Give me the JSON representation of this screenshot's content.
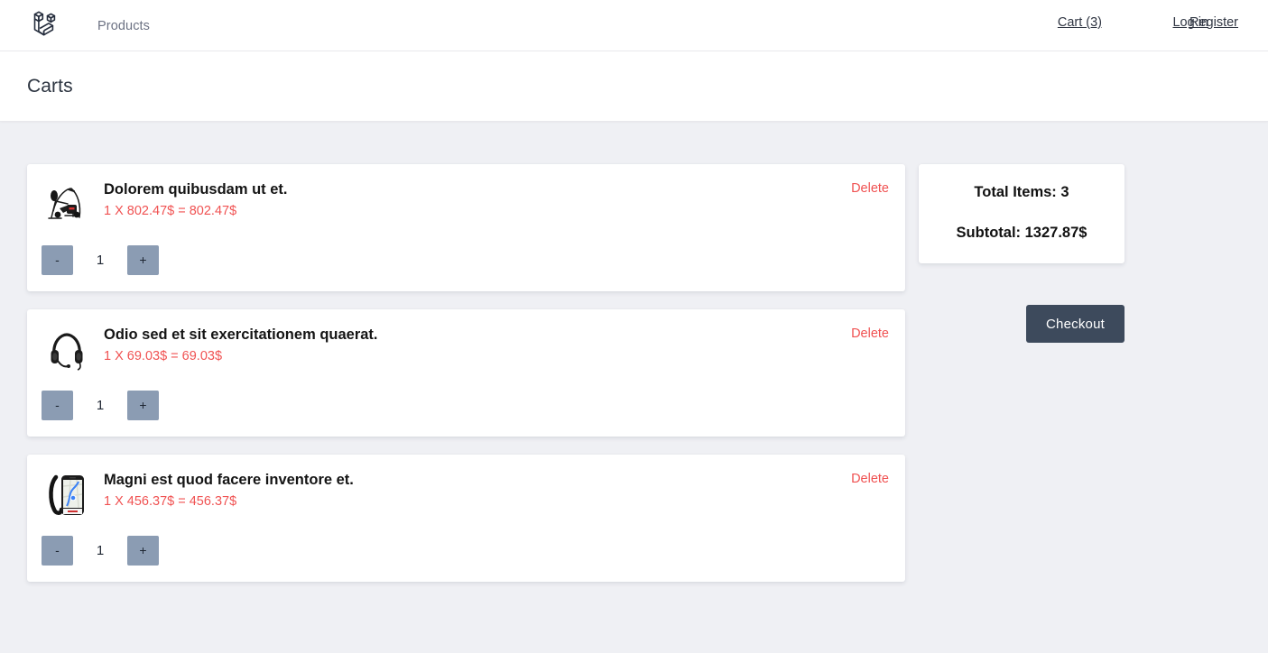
{
  "navbar": {
    "logo_name": "laravel-logo",
    "products_label": "Products",
    "cart_label": "Cart (3)",
    "login_label": "Log in",
    "register_label": "Register"
  },
  "page": {
    "title": "Carts"
  },
  "cart": {
    "items": [
      {
        "image": "elliptical-trainer-photo",
        "title": "Dolorem quibusdam ut et.",
        "price_line": "1 X 802.47$ = 802.47$",
        "unit_price": "802.47$",
        "line_total": "802.47$",
        "quantity": "1",
        "decrement_label": "-",
        "increment_label": "+",
        "delete_label": "Delete"
      },
      {
        "image": "headset-photo",
        "title": "Odio sed et sit exercitationem quaerat.",
        "price_line": "1 X 69.03$ = 69.03$",
        "unit_price": "69.03$",
        "line_total": "69.03$",
        "quantity": "1",
        "decrement_label": "-",
        "increment_label": "+",
        "delete_label": "Delete"
      },
      {
        "image": "smartphone-map-photo",
        "title": "Magni est quod facere inventore et.",
        "price_line": "1 X 456.37$ = 456.37$",
        "unit_price": "456.37$",
        "line_total": "456.37$",
        "quantity": "1",
        "decrement_label": "-",
        "increment_label": "+",
        "delete_label": "Delete"
      }
    ]
  },
  "summary": {
    "total_items": "Total Items: 3",
    "subtotal": "Subtotal: 1327.87$",
    "checkout_label": "Checkout"
  },
  "colors": {
    "page_background": "#eff0f4",
    "card_background": "#ffffff",
    "price_red": "#f05252",
    "qty_button": "#8b9cb3",
    "checkout_button": "#3d4a5c",
    "text_dark": "#2d3748",
    "nav_muted": "#6c7283"
  }
}
